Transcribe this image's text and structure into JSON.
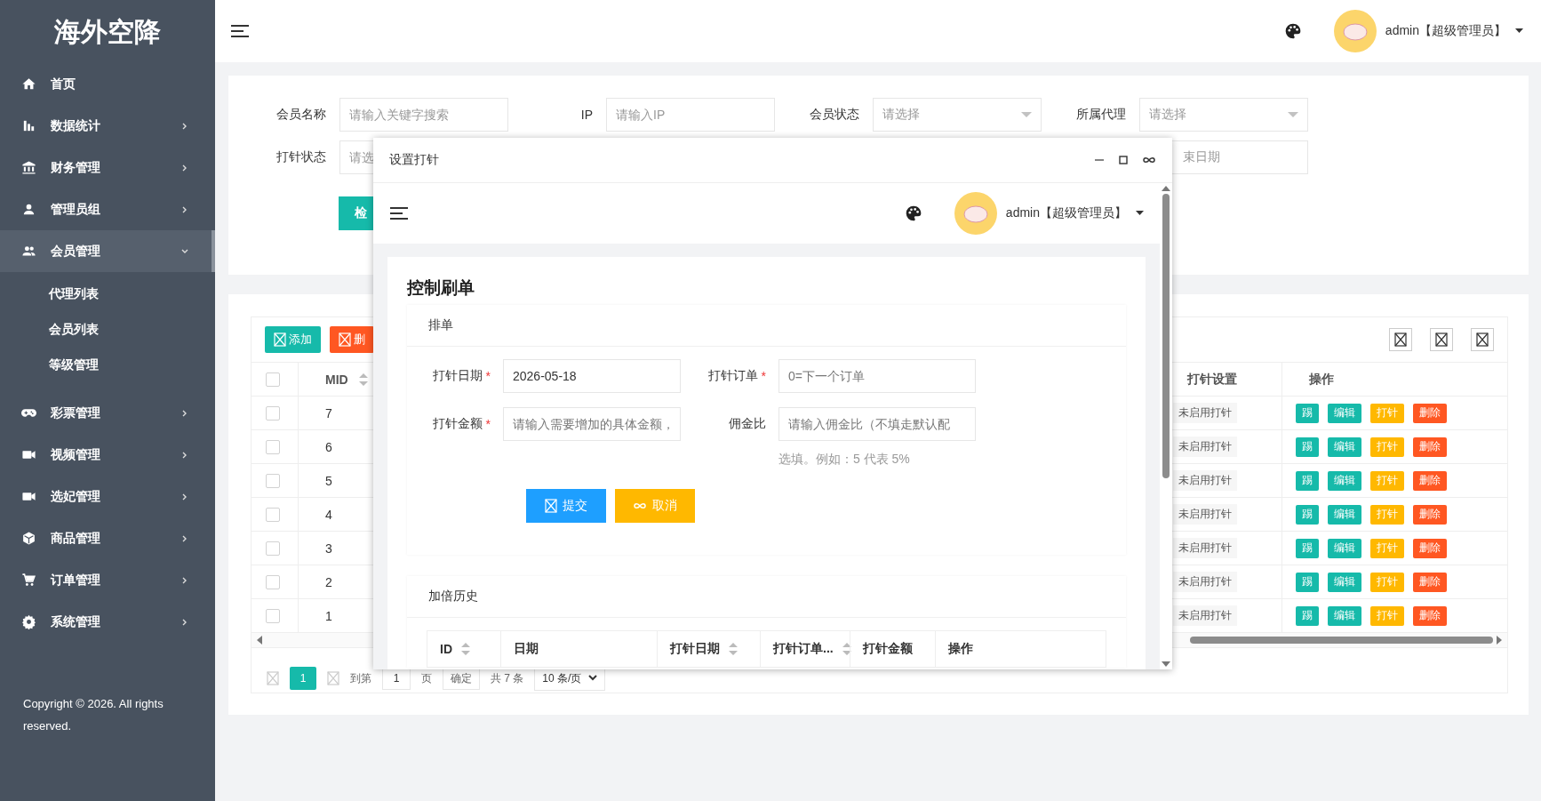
{
  "sidebar": {
    "logo": "海外空降",
    "items": [
      {
        "label": "首页",
        "kind": "link"
      },
      {
        "label": "数据统计",
        "kind": "menu",
        "expanded": false
      },
      {
        "label": "财务管理",
        "kind": "menu",
        "expanded": false
      },
      {
        "label": "管理员组",
        "kind": "menu",
        "expanded": false
      },
      {
        "label": "会员管理",
        "kind": "menu",
        "expanded": true,
        "children": [
          {
            "label": "代理列表"
          },
          {
            "label": "会员列表"
          },
          {
            "label": "等级管理"
          }
        ]
      },
      {
        "label": "彩票管理",
        "kind": "menu",
        "expanded": false
      },
      {
        "label": "视频管理",
        "kind": "menu",
        "expanded": false
      },
      {
        "label": "选妃管理",
        "kind": "menu",
        "expanded": false
      },
      {
        "label": "商品管理",
        "kind": "menu",
        "expanded": false
      },
      {
        "label": "订单管理",
        "kind": "menu",
        "expanded": false
      },
      {
        "label": "系统管理",
        "kind": "menu",
        "expanded": false
      }
    ],
    "copyright": "Copyright © 2026. All rights reserved."
  },
  "header": {
    "user": "admin【超级管理员】"
  },
  "filters": {
    "fields": [
      {
        "label": "会员名称",
        "kind": "input",
        "placeholder": "请输入关键字搜索"
      },
      {
        "label": "IP",
        "kind": "input",
        "placeholder": "请输入IP"
      },
      {
        "label": "会员状态",
        "kind": "select",
        "placeholder": "请选择"
      },
      {
        "label": "所属代理",
        "kind": "select",
        "placeholder": "请选择"
      },
      {
        "label": "打针状态",
        "kind": "input",
        "placeholder": "请选"
      }
    ],
    "end_date": {
      "placeholder": "束日期"
    },
    "search_button": "检"
  },
  "table": {
    "toolbar": [
      {
        "label": "添加",
        "kind": "add"
      },
      {
        "label": "删",
        "kind": "danger"
      }
    ],
    "header_checked": false,
    "columns": [
      {
        "label": "MID",
        "sortable": true
      },
      {
        "label": "打针设置",
        "sortable": false
      },
      {
        "label": "操作",
        "sortable": false
      }
    ],
    "rows": [
      {
        "checked": false,
        "mid": "7",
        "status": "未启用打针",
        "actions": [
          {
            "label": "踢",
            "kind": "normal"
          },
          {
            "label": "编辑",
            "kind": "normal"
          },
          {
            "label": "打针",
            "kind": "warn"
          },
          {
            "label": "删除",
            "kind": "danger"
          }
        ]
      },
      {
        "checked": false,
        "mid": "6",
        "status": "未启用打针",
        "actions": [
          {
            "label": "踢",
            "kind": "normal"
          },
          {
            "label": "编辑",
            "kind": "normal"
          },
          {
            "label": "打针",
            "kind": "warn"
          },
          {
            "label": "删除",
            "kind": "danger"
          }
        ]
      },
      {
        "checked": false,
        "mid": "5",
        "status": "未启用打针",
        "actions": [
          {
            "label": "踢",
            "kind": "normal"
          },
          {
            "label": "编辑",
            "kind": "normal"
          },
          {
            "label": "打针",
            "kind": "warn"
          },
          {
            "label": "删除",
            "kind": "danger"
          }
        ]
      },
      {
        "checked": false,
        "mid": "4",
        "status": "未启用打针",
        "actions": [
          {
            "label": "踢",
            "kind": "normal"
          },
          {
            "label": "编辑",
            "kind": "normal"
          },
          {
            "label": "打针",
            "kind": "warn"
          },
          {
            "label": "删除",
            "kind": "danger"
          }
        ]
      },
      {
        "checked": false,
        "mid": "3",
        "status": "未启用打针",
        "actions": [
          {
            "label": "踢",
            "kind": "normal"
          },
          {
            "label": "编辑",
            "kind": "normal"
          },
          {
            "label": "打针",
            "kind": "warn"
          },
          {
            "label": "删除",
            "kind": "danger"
          }
        ]
      },
      {
        "checked": false,
        "mid": "2",
        "status": "未启用打针",
        "actions": [
          {
            "label": "踢",
            "kind": "normal"
          },
          {
            "label": "编辑",
            "kind": "normal"
          },
          {
            "label": "打针",
            "kind": "warn"
          },
          {
            "label": "删除",
            "kind": "danger"
          }
        ]
      },
      {
        "checked": false,
        "mid": "1",
        "status": "未启用打针",
        "actions": [
          {
            "label": "踢",
            "kind": "normal"
          },
          {
            "label": "编辑",
            "kind": "normal"
          },
          {
            "label": "打针",
            "kind": "warn"
          },
          {
            "label": "删除",
            "kind": "danger"
          }
        ]
      }
    ]
  },
  "pagination": {
    "pages": [
      {
        "label": "1",
        "selected": true
      }
    ],
    "goto_label": "到第",
    "goto_value": "1",
    "page_unit": "页",
    "confirm": "确定",
    "total": "共 7 条",
    "page_size": "10 条/页"
  },
  "dialog": {
    "title": "设置打针",
    "required_mark": "*",
    "header": {
      "user": "admin【超级管理员】"
    },
    "card_title": "控制刷单",
    "section": "排单",
    "fields": [
      {
        "label": "打针日期",
        "required": true,
        "value": "2026-05-18"
      },
      {
        "label": "打针订单",
        "required": true,
        "placeholder": "0=下一个订单"
      },
      {
        "label": "打针金额",
        "required": true,
        "placeholder": "请输入需要增加的具体金额，"
      },
      {
        "label": "佣金比",
        "required": false,
        "placeholder": "请输入佣金比（不填走默认配",
        "hint": "选填。例如：5 代表 5%"
      }
    ],
    "buttons": [
      {
        "label": "提交",
        "kind": "primary"
      },
      {
        "label": "取消",
        "kind": "warning"
      }
    ],
    "history_title": "加倍历史",
    "history_columns": [
      {
        "label": "ID",
        "sortable": true
      },
      {
        "label": "日期",
        "sortable": false
      },
      {
        "label": "打针日期",
        "sortable": true
      },
      {
        "label": "打针订单...",
        "sortable": true
      },
      {
        "label": "打针金额",
        "sortable": false
      },
      {
        "label": "操作",
        "sortable": false
      }
    ]
  }
}
